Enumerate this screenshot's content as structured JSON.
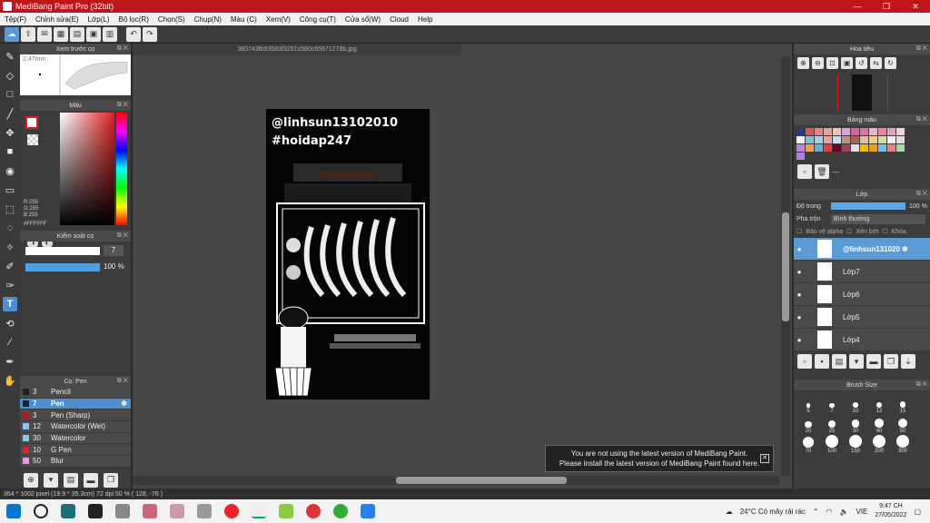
{
  "window": {
    "title": "MediBang Paint Pro (32bit)",
    "controls": [
      "—",
      "❐",
      "✕"
    ]
  },
  "menu": [
    "Tệp(F)",
    "Chỉnh sửa(E)",
    "Lớp(L)",
    "Bộ lọc(R)",
    "Chọn(S)",
    "Chụp(N)",
    "Màu (C)",
    "Xem(V)",
    "Công cụ(T)",
    "Cửa sổ(W)",
    "Cloud",
    "Help"
  ],
  "preview": {
    "title": "Xem trước cọ",
    "zoom": "2.47mm"
  },
  "color": {
    "title": "Màu",
    "r": "R:255",
    "g": "G:255",
    "b": "B:255",
    "hex": "#FFFFFF"
  },
  "brush_control": {
    "title": "Kiểm soát cọ",
    "size": "7",
    "opacity": "100 %"
  },
  "brush_list": {
    "title": "Cọ: Pen",
    "items": [
      {
        "size": "3",
        "name": "Pencil",
        "color": "#222222"
      },
      {
        "size": "7",
        "name": "Pen",
        "color": "#222222"
      },
      {
        "size": "3",
        "name": "Pen (Sharp)",
        "color": "#c0151c"
      },
      {
        "size": "12",
        "name": "Watercolor (Wet)",
        "color": "#7ec8f0"
      },
      {
        "size": "30",
        "name": "Watercolor",
        "color": "#7ec8f0"
      },
      {
        "size": "10",
        "name": "G Pen",
        "color": "#e0202a"
      },
      {
        "size": "50",
        "name": "Blur",
        "color": "#e79ae8"
      }
    ]
  },
  "document": {
    "tab": "380743fb93583f3261c580c65971278b.jpg",
    "line1": "@linhsun13102010",
    "line2": "#hoidap247"
  },
  "notice": {
    "line1": "You are not using the latest version of MediBang Paint.",
    "line2": "Please install the latest version of MediBang Paint found here."
  },
  "navigator": {
    "title": "Hoa tiêu"
  },
  "palette": {
    "title": "Bảng màu",
    "extra": "---",
    "colors": [
      "#1f3d8a",
      "#d45a5a",
      "#e68585",
      "#e5a0a0",
      "#f4c0c0",
      "#d4a0e0",
      "#e060a0",
      "#e070b0",
      "#f0b0d0",
      "#f080a0",
      "#e0a0c0",
      "#f4d0e0",
      "#f0f0f0",
      "#80c0e0",
      "#a0d0f0",
      "#f0a0a0",
      "#c0e0f0",
      "#c09080",
      "#b06050",
      "#e0c0a0",
      "#f0d080",
      "#d0e0a0",
      "#f0f0f0",
      "#e0e0e0",
      "#c080e0",
      "#f0a040",
      "#60b0e0",
      "#e04040",
      "#700020",
      "#a04060",
      "#e0e0e0",
      "#f0c000",
      "#f0a000",
      "#70c0f0",
      "#f08080",
      "#a0e0a0",
      "#b080e0"
    ]
  },
  "layers": {
    "title": "Lớp",
    "opacity_label": "Độ trong",
    "opacity_value": "100 %",
    "blend_label": "Pha trộn",
    "blend_value": "Bình thường",
    "protect_alpha": "Bảo vệ alpha",
    "clipping": "Xén bớt",
    "lock": "Khóa",
    "items": [
      "@linhsun131020",
      "Lớp7",
      "Lớp6",
      "Lớp5",
      "Lớp4"
    ]
  },
  "brush_size": {
    "title": "Brush Size",
    "sizes": [
      "5",
      "7",
      "10",
      "12",
      "15",
      "20",
      "25",
      "30",
      "40",
      "50",
      "70",
      "100",
      "150",
      "200",
      "300"
    ]
  },
  "status": {
    "text": "364 * 1002 pixel  (19.9 * 35.3cm)  72 dpi  50 %  ( 128, -76 )"
  },
  "taskbar": {
    "weather": "24°C  Có mây rải rác",
    "lang": "VIE",
    "time": "9:47 CH",
    "date": "27/05/2022"
  }
}
